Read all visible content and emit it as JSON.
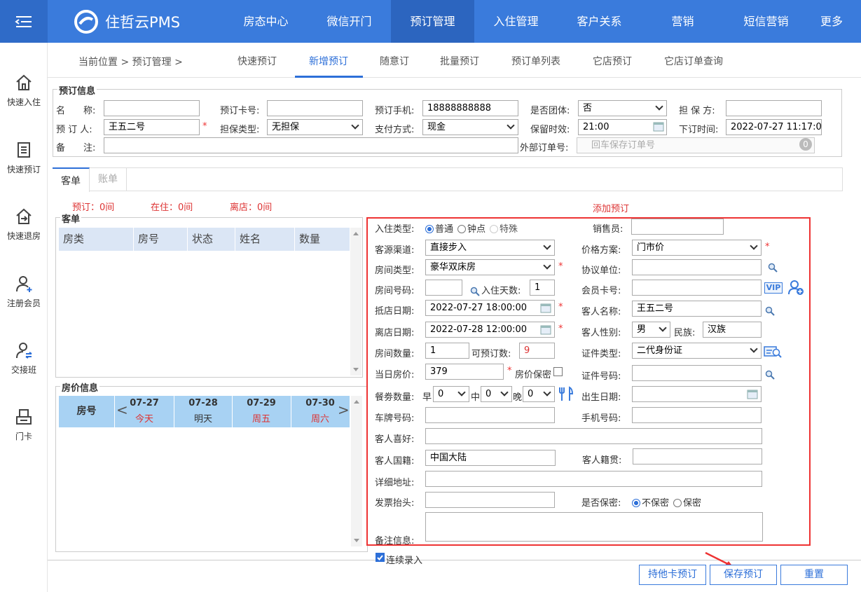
{
  "app": {
    "logo_text": "住哲云PMS"
  },
  "nav": [
    "房态中心",
    "微信开门",
    "预订管理",
    "入住管理",
    "客户关系",
    "营销",
    "短信营销",
    "更多(1"
  ],
  "sidebar": [
    "快速入住",
    "快速预订",
    "快速退房",
    "注册会员",
    "交接班",
    "门卡"
  ],
  "crumb": "当前位置 > 预订管理 >",
  "subtabs": [
    "快速预订",
    "新增预订",
    "随意订",
    "批量预订",
    "预订单列表",
    "它店预订",
    "它店订单查询"
  ],
  "booking": {
    "legend": "预订信息",
    "name_label": "名　　称:",
    "card_label": "预订卡号:",
    "phone_label": "预订手机:",
    "phone": "18888888888",
    "group_label": "是否团体:",
    "group": "否",
    "guarantor_label": "担 保 方:",
    "booker_label": "预 订 人:",
    "booker": "王五二号",
    "gtype_label": "担保类型:",
    "gtype": "无担保",
    "pay_label": "支付方式:",
    "pay": "现金",
    "hold_label": "保留时效:",
    "hold": "21:00",
    "otime_label": "下订时间:",
    "otime": "2022-07-27 11:17:0",
    "remark_label": "备　　注:",
    "ext_label": "外部订单号:",
    "ext_placeholder": "回车保存订单号",
    "ext_count": "0"
  },
  "tabs": [
    "客单",
    "账单"
  ],
  "stats": {
    "booked": "预订：0间",
    "stay": "在住：0间",
    "leave": "离店：0间"
  },
  "add_title": "添加预订",
  "guest_list": {
    "legend": "客单",
    "cols": [
      "房类",
      "房号",
      "状态",
      "姓名",
      "数量"
    ]
  },
  "price": {
    "legend": "房价信息",
    "room_col": "房号",
    "days": [
      {
        "d": "07-27",
        "w": "今天"
      },
      {
        "d": "07-28",
        "w": "明天"
      },
      {
        "d": "07-29",
        "w": "周五"
      },
      {
        "d": "07-30",
        "w": "周六"
      }
    ]
  },
  "form": {
    "stay_type_label": "入住类型:",
    "stay_types": [
      "普通",
      "钟点",
      "特殊"
    ],
    "sales_label": "销售员:",
    "channel_label": "客源渠道:",
    "channel": "直接步入",
    "price_plan_label": "价格方案:",
    "price_plan": "门市价",
    "room_type_label": "房间类型:",
    "room_type": "豪华双床房",
    "agreement_label": "协议单位:",
    "room_no_label": "房间号码:",
    "days_label": "入住天数:",
    "days": "1",
    "member_label": "会员卡号:",
    "vip": "VIP",
    "arrive_label": "抵店日期:",
    "arrive": "2022-07-27 18:00:00",
    "guest_name_label": "客人名称:",
    "guest_name": "王五二号",
    "depart_label": "离店日期:",
    "depart": "2022-07-28 12:00:00",
    "gender_label": "客人性别:",
    "gender": "男",
    "ethnic_label": "民族:",
    "ethnic": "汉族",
    "room_count_label": "房间数量:",
    "room_count": "1",
    "avail_label": "可预订数:",
    "avail": "9",
    "id_type_label": "证件类型:",
    "id_type": "二代身份证",
    "rate_label": "当日房价:",
    "rate": "379",
    "rate_secret_label": "房价保密",
    "id_no_label": "证件号码:",
    "meal_label": "餐劵数量:",
    "breakfast_label": "早",
    "breakfast": "0",
    "lunch_label": "中",
    "lunch": "0",
    "dinner_label": "晚",
    "dinner": "0",
    "birth_label": "出生日期:",
    "plate_label": "车牌号码:",
    "mobile_label": "手机号码:",
    "hobby_label": "客人喜好:",
    "nation_label": "客人国籍:",
    "nation": "中国大陆",
    "native_label": "客人籍贯:",
    "address_label": "详细地址:",
    "invoice_label": "发票抬头:",
    "secret_label": "是否保密:",
    "secret_opts": [
      "不保密",
      "保密"
    ],
    "note_label": "备注信息:"
  },
  "continuous_label": "连续录入",
  "buttons": {
    "other_card": "持他卡预订",
    "save": "保存预订",
    "reset": "重置"
  },
  "colors": {
    "primary": "#3a7bdc",
    "required": "#e33333"
  }
}
